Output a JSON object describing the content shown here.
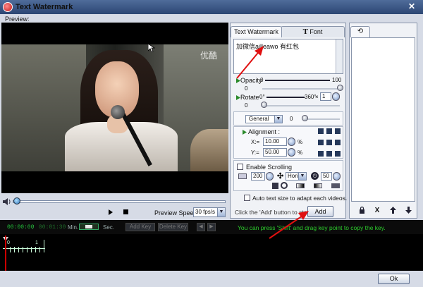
{
  "window": {
    "title": "Text Watermark",
    "close_symbol": "✕"
  },
  "preview": {
    "label": "Preview:",
    "video_watermark": "优酷",
    "speed_label": "Preview Speed:",
    "speed_value": "30 fps/s"
  },
  "text_panel": {
    "tabs": [
      {
        "label": "Text Watermark"
      },
      {
        "label": "Font",
        "icon": "font-T-icon"
      }
    ],
    "watermark_text": "加微信ailleawo 有红包",
    "opacity": {
      "label": "Opacity",
      "min": "0",
      "max": "100",
      "value": "0"
    },
    "rotate": {
      "label": "Rotate",
      "min": "0°",
      "max": "360°",
      "multiplier_symbol": "×",
      "multiplier_value": "1",
      "value": "0"
    },
    "position_mode": {
      "value": "General",
      "amount": "0"
    },
    "alignment": {
      "label": "Alignment :",
      "x_label": "X:=",
      "x_value": "10.00",
      "y_label": "Y:=",
      "y_value": "50.00",
      "unit": "%"
    },
    "scrolling": {
      "checkbox_label": "Enable Scrolling",
      "speed_value": "200",
      "direction_value": "Horiz",
      "interval_value": "50"
    },
    "auto_size_label": "Auto text size to adapt each videos.",
    "add_hint": "Click the 'Add' button to start ->",
    "add_button_label": "Add"
  },
  "list_panel": {
    "tab_icon": "refresh-icon",
    "tools": [
      {
        "icon": "lock-icon",
        "glyph": "🔒"
      },
      {
        "icon": "delete-icon",
        "glyph": "X"
      },
      {
        "icon": "up-arrow-icon",
        "glyph": "▲"
      },
      {
        "icon": "down-arrow-icon",
        "glyph": "▼"
      }
    ]
  },
  "timeline": {
    "current_time": "00:00:00",
    "separator": "/",
    "total_time": "00:01:30",
    "min_label": "Min.",
    "sec_label": "Sec.",
    "add_key_label": "Add Key",
    "delete_key_label": "Delete Key",
    "prev_key": "◀",
    "next_key": "▶",
    "hint": "You can press 'Shift' and drag key point to copy the key.",
    "ruler_labels": [
      "0",
      "1"
    ]
  },
  "footer": {
    "ok_label": "Ok"
  },
  "colors": {
    "title_bar": "#2c4673",
    "timeline_text": "#22c13a",
    "annotation_arrow": "#e01010"
  }
}
